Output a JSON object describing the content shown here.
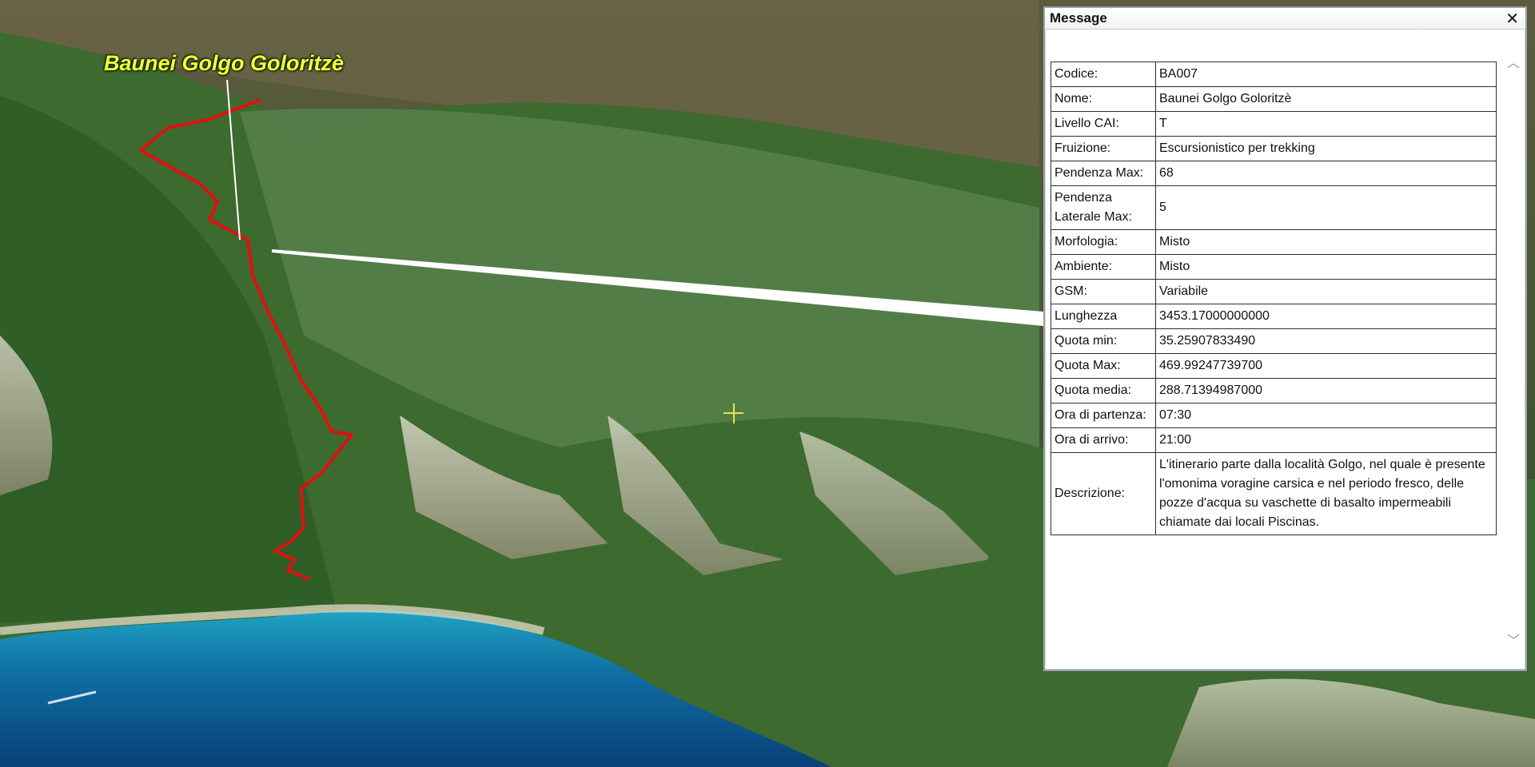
{
  "map": {
    "place_label": "Baunei Golgo Goloritzè"
  },
  "window": {
    "title": "Message",
    "close_label": "✕"
  },
  "scroll": {
    "up": "︿",
    "down": "﹀"
  },
  "fields": [
    {
      "key": "Codice:",
      "value": "BA007"
    },
    {
      "key": "Nome:",
      "value": "Baunei Golgo Goloritzè"
    },
    {
      "key": "Livello CAI:",
      "value": "T"
    },
    {
      "key": "Fruizione:",
      "value": "Escursionistico per trekking"
    },
    {
      "key": "Pendenza Max:",
      "value": "68"
    },
    {
      "key": "Pendenza Laterale Max:",
      "value": "5"
    },
    {
      "key": "Morfologia:",
      "value": "Misto"
    },
    {
      "key": "Ambiente:",
      "value": "Misto"
    },
    {
      "key": "GSM:",
      "value": "Variabile"
    },
    {
      "key": "Lunghezza",
      "value": "3453.17000000000"
    },
    {
      "key": "Quota min:",
      "value": "35.25907833490"
    },
    {
      "key": "Quota Max:",
      "value": "469.99247739700"
    },
    {
      "key": "Quota media:",
      "value": "288.71394987000"
    },
    {
      "key": "Ora di partenza:",
      "value": "07:30"
    },
    {
      "key": "Ora di arrivo:",
      "value": "21:00"
    },
    {
      "key": "Descrizione:",
      "value": "L'itinerario parte dalla località Golgo, nel quale è presente l'omonima voragine carsica e nel periodo fresco, delle pozze d'acqua su vaschette di basalto impermeabili chiamate dai locali Piscinas."
    }
  ],
  "colors": {
    "route": "#e01010",
    "label": "#f4ff3a",
    "sea": "#0b5e8e"
  }
}
